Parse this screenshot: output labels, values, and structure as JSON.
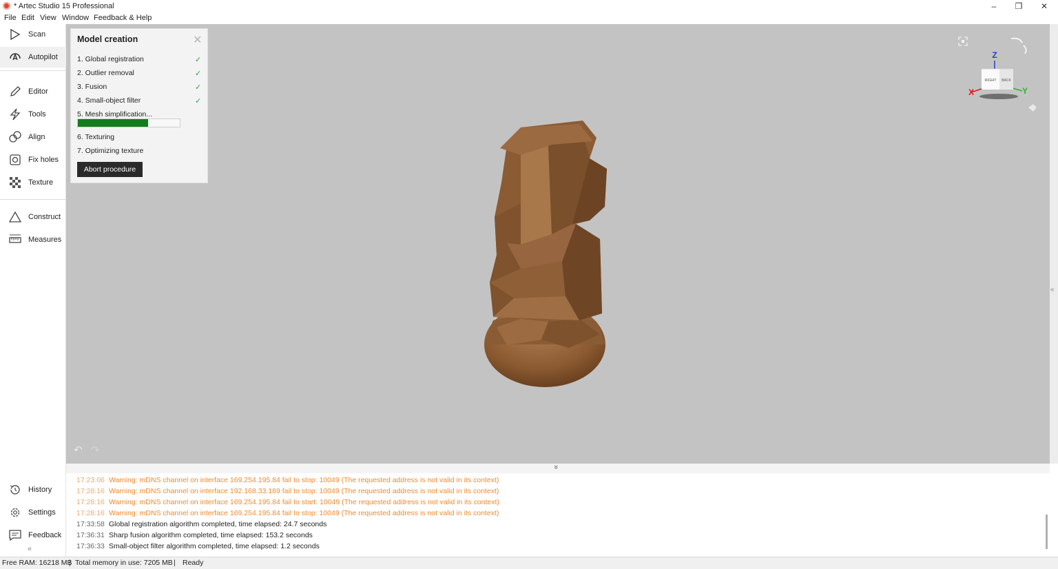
{
  "window": {
    "title": "* Artec Studio 15 Professional",
    "controls": {
      "minimize": "–",
      "maximize": "❐",
      "close": "✕"
    }
  },
  "menu": [
    "File",
    "Edit",
    "View",
    "Window",
    "Feedback & Help"
  ],
  "sidebar": {
    "top_items": [
      {
        "label": "Scan",
        "icon": "play-outline-icon"
      },
      {
        "label": "Autopilot",
        "icon": "autopilot-icon",
        "active": true
      }
    ],
    "edit_items": [
      {
        "label": "Editor",
        "icon": "pencil-icon"
      },
      {
        "label": "Tools",
        "icon": "lightning-icon"
      },
      {
        "label": "Align",
        "icon": "align-icon"
      },
      {
        "label": "Fix holes",
        "icon": "fix-holes-icon"
      },
      {
        "label": "Texture",
        "icon": "checkerboard-icon"
      }
    ],
    "measure_items": [
      {
        "label": "Construct",
        "icon": "triangle-icon"
      },
      {
        "label": "Measures",
        "icon": "ruler-icon"
      }
    ],
    "bottom_items": [
      {
        "label": "History",
        "icon": "history-icon"
      },
      {
        "label": "Settings",
        "icon": "gear-icon"
      },
      {
        "label": "Feedback",
        "icon": "chat-icon"
      }
    ],
    "collapse": "«"
  },
  "model_creation": {
    "title": "Model creation",
    "close": "✕",
    "steps": [
      {
        "label": "1. Global registration",
        "done": true
      },
      {
        "label": "2. Outlier removal",
        "done": true
      },
      {
        "label": "3. Fusion",
        "done": true
      },
      {
        "label": "4. Small-object filter",
        "done": true
      },
      {
        "label": "5. Mesh simplification...",
        "done": false
      },
      {
        "label": "6. Texturing",
        "done": false
      },
      {
        "label": "7. Optimizing texture",
        "done": false
      }
    ],
    "check_glyph": "✓",
    "progress": 0.69,
    "abort_label": "Abort procedure"
  },
  "viewport": {
    "background": "#c3c3c3",
    "model_color": "#8a5a33",
    "axes": {
      "x": "X",
      "y": "Y",
      "z": "Z"
    },
    "cube_faces": {
      "right": "RIGHT",
      "back": "BACK"
    },
    "axis_colors": {
      "x": "#e2141c",
      "y": "#2fb52a",
      "z": "#1f3fd6"
    },
    "undo": "↶",
    "redo": "↷"
  },
  "log": {
    "expand_glyph": "»",
    "entries": [
      {
        "time": "17:23:06",
        "text": "Warning: mDNS channel on interface 169.254.195.84 fail to stop: 10049 (The requested address is not valid in its context)",
        "level": "warn"
      },
      {
        "time": "17:28:16",
        "text": "Warning: mDNS channel on interface 192.168.33.189 fail to stop: 10049 (The requested address is not valid in its context)",
        "level": "warn"
      },
      {
        "time": "17:28:16",
        "text": "Warning: mDNS channel on interface 169.254.195.84 fail to start: 10049 (The requested address is not valid in its context)",
        "level": "warn"
      },
      {
        "time": "17:28:16",
        "text": "Warning: mDNS channel on interface 169.254.195.84 fail to stop: 10049 (The requested address is not valid in its context)",
        "level": "warn"
      },
      {
        "time": "17:33:58",
        "text": "Global registration algorithm completed, time elapsed: 24.7 seconds",
        "level": "info"
      },
      {
        "time": "17:36:31",
        "text": "Sharp fusion algorithm completed, time elapsed: 153.2 seconds",
        "level": "info"
      },
      {
        "time": "17:36:33",
        "text": "Small-object filter algorithm completed, time elapsed: 1.2 seconds",
        "level": "info"
      }
    ]
  },
  "status": {
    "free_ram": "Free RAM: 16218 MB",
    "sep1": "|",
    "total_memory": "Total memory in use: 7205 MB",
    "sep2": "|",
    "state": "Ready"
  }
}
